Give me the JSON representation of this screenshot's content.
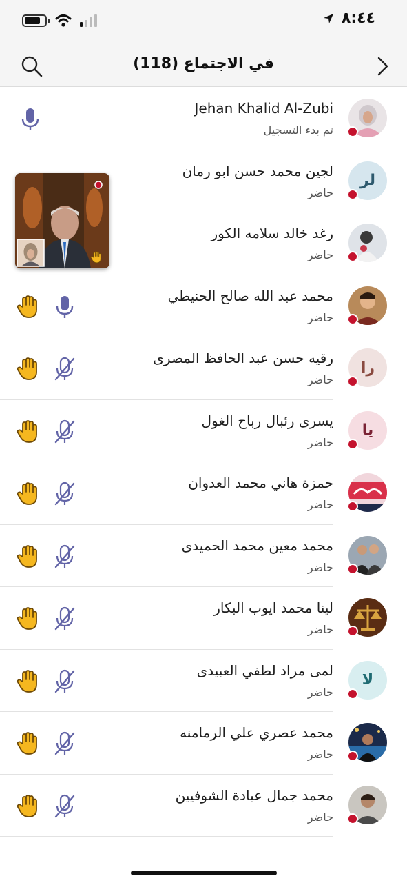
{
  "status_bar": {
    "time": "٨:٤٤"
  },
  "header": {
    "title": "في الاجتماع (118)",
    "search_icon": "search-icon",
    "back_icon": "chevron-right-icon"
  },
  "colors": {
    "mic_purple": "#6264a7",
    "presence_red": "#c4122d",
    "hand_yellow": "#f5b71f"
  },
  "participants": [
    {
      "name": "Jehan Khalid Al-Zubi",
      "status": "تم بدء التسجيل",
      "avatar": "photo",
      "mic": "on",
      "hand": false
    },
    {
      "name": "لجين محمد حسن ابو رمان",
      "status": "حاضر",
      "avatar": "لر",
      "avatar_color": "#d6e6ee",
      "avatar_text_color": "#2e5a6e",
      "mic": "covered",
      "hand": true
    },
    {
      "name": "رغد خالد سلامه الكور",
      "status": "حاضر",
      "avatar": "photo",
      "mic": "covered",
      "hand": true
    },
    {
      "name": "محمد عبد الله صالح الحنيطي",
      "status": "حاضر",
      "avatar": "photo",
      "mic": "on",
      "hand": true
    },
    {
      "name": "رقيه حسن عبد الحافظ المصرى",
      "status": "حاضر",
      "avatar": "را",
      "avatar_color": "#f0e2e0",
      "avatar_text_color": "#8a4a40",
      "mic": "muted",
      "hand": true
    },
    {
      "name": "يسرى رئبال رباح الغول",
      "status": "حاضر",
      "avatar": "يا",
      "avatar_color": "#f6dde2",
      "avatar_text_color": "#7a2234",
      "mic": "muted",
      "hand": true
    },
    {
      "name": "حمزة هاني محمد العدوان",
      "status": "حاضر",
      "avatar": "photo",
      "mic": "muted",
      "hand": true
    },
    {
      "name": "محمد معين محمد الحميدى",
      "status": "حاضر",
      "avatar": "photo",
      "mic": "muted",
      "hand": true
    },
    {
      "name": "لينا محمد ايوب البكار",
      "status": "حاضر",
      "avatar": "photo",
      "mic": "muted",
      "hand": true
    },
    {
      "name": "لمى مراد لطفي العبيدى",
      "status": "حاضر",
      "avatar": "لا",
      "avatar_color": "#d8eef0",
      "avatar_text_color": "#1f6b72",
      "mic": "muted",
      "hand": true
    },
    {
      "name": "محمد عصري علي الرمامنه",
      "status": "حاضر",
      "avatar": "photo",
      "mic": "muted",
      "hand": true
    },
    {
      "name": "محمد جمال عيادة الشوفيين",
      "status": "حاضر",
      "avatar": "photo",
      "mic": "muted",
      "hand": true
    }
  ]
}
